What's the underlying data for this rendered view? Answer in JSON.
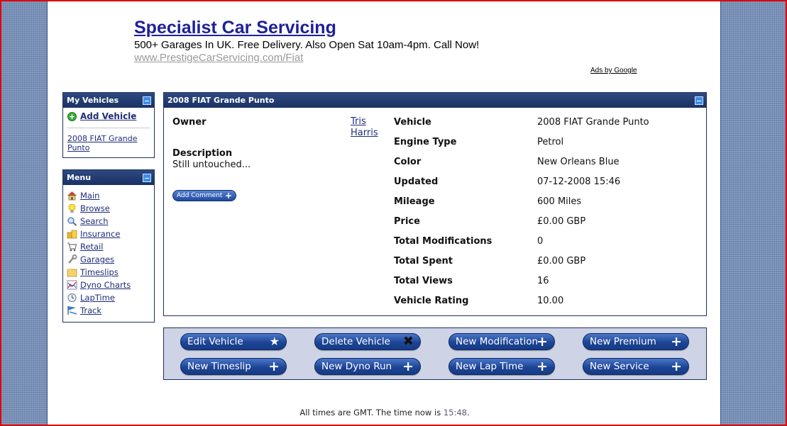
{
  "ad": {
    "title": "Specialist Car Servicing",
    "text": "500+ Garages In UK. Free Delivery. Also Open Sat 10am-4pm. Call Now!",
    "url": "www.PrestigeCarServicing.com/Fiat",
    "ads_by": "Ads by Google"
  },
  "my_vehicles": {
    "title": "My Vehicles",
    "add_label": "Add Vehicle",
    "vehicle_link": "2008 FIAT Grande Punto"
  },
  "menu": {
    "title": "Menu",
    "items": [
      {
        "label": "Main",
        "icon": "home-icon"
      },
      {
        "label": "Browse",
        "icon": "lightbulb-icon"
      },
      {
        "label": "Search",
        "icon": "magnifier-icon"
      },
      {
        "label": "Insurance",
        "icon": "insurance-icon"
      },
      {
        "label": "Retail",
        "icon": "cart-icon"
      },
      {
        "label": "Garages",
        "icon": "wrench-icon"
      },
      {
        "label": "Timeslips",
        "icon": "folder-icon"
      },
      {
        "label": "Dyno Charts",
        "icon": "chart-icon"
      },
      {
        "label": "LapTime",
        "icon": "clock-icon"
      },
      {
        "label": "Track",
        "icon": "flag-icon"
      }
    ]
  },
  "vehicle": {
    "panel_title": "2008 FIAT Grande Punto",
    "owner_label": "Owner",
    "owner_name": "Tris Harris",
    "description_label": "Description",
    "description": "Still untouched...",
    "add_comment": "Add Comment",
    "specs": [
      {
        "label": "Vehicle",
        "value": "2008 FIAT Grande Punto"
      },
      {
        "label": "Engine Type",
        "value": "Petrol"
      },
      {
        "label": "Color",
        "value": "New Orleans Blue"
      },
      {
        "label": "Updated",
        "value": "07-12-2008 15:46"
      },
      {
        "label": "Mileage",
        "value": "600 Miles"
      },
      {
        "label": "Price",
        "value": "£0.00 GBP"
      },
      {
        "label": "Total Modifications",
        "value": "0"
      },
      {
        "label": "Total Spent",
        "value": "£0.00 GBP"
      },
      {
        "label": "Total Views",
        "value": "16"
      },
      {
        "label": "Vehicle Rating",
        "value": "10.00"
      }
    ]
  },
  "actions": [
    {
      "label": "Edit Vehicle",
      "icon": "star-icon"
    },
    {
      "label": "Delete Vehicle",
      "icon": "x-icon"
    },
    {
      "label": "New Modification",
      "icon": "plus-icon"
    },
    {
      "label": "New Premium",
      "icon": "plus-icon"
    },
    {
      "label": "New Timeslip",
      "icon": "plus-icon"
    },
    {
      "label": "New Dyno Run",
      "icon": "plus-icon"
    },
    {
      "label": "New Lap Time",
      "icon": "plus-icon"
    },
    {
      "label": "New Service",
      "icon": "plus-icon"
    }
  ],
  "footer": {
    "text": "All times are GMT. The time now is ",
    "time": "15:48",
    "end": "."
  },
  "colors": {
    "header_bar": "#1a3163",
    "link": "#1f2d7a",
    "background": "#6d86b0",
    "button": "#1d4596"
  }
}
